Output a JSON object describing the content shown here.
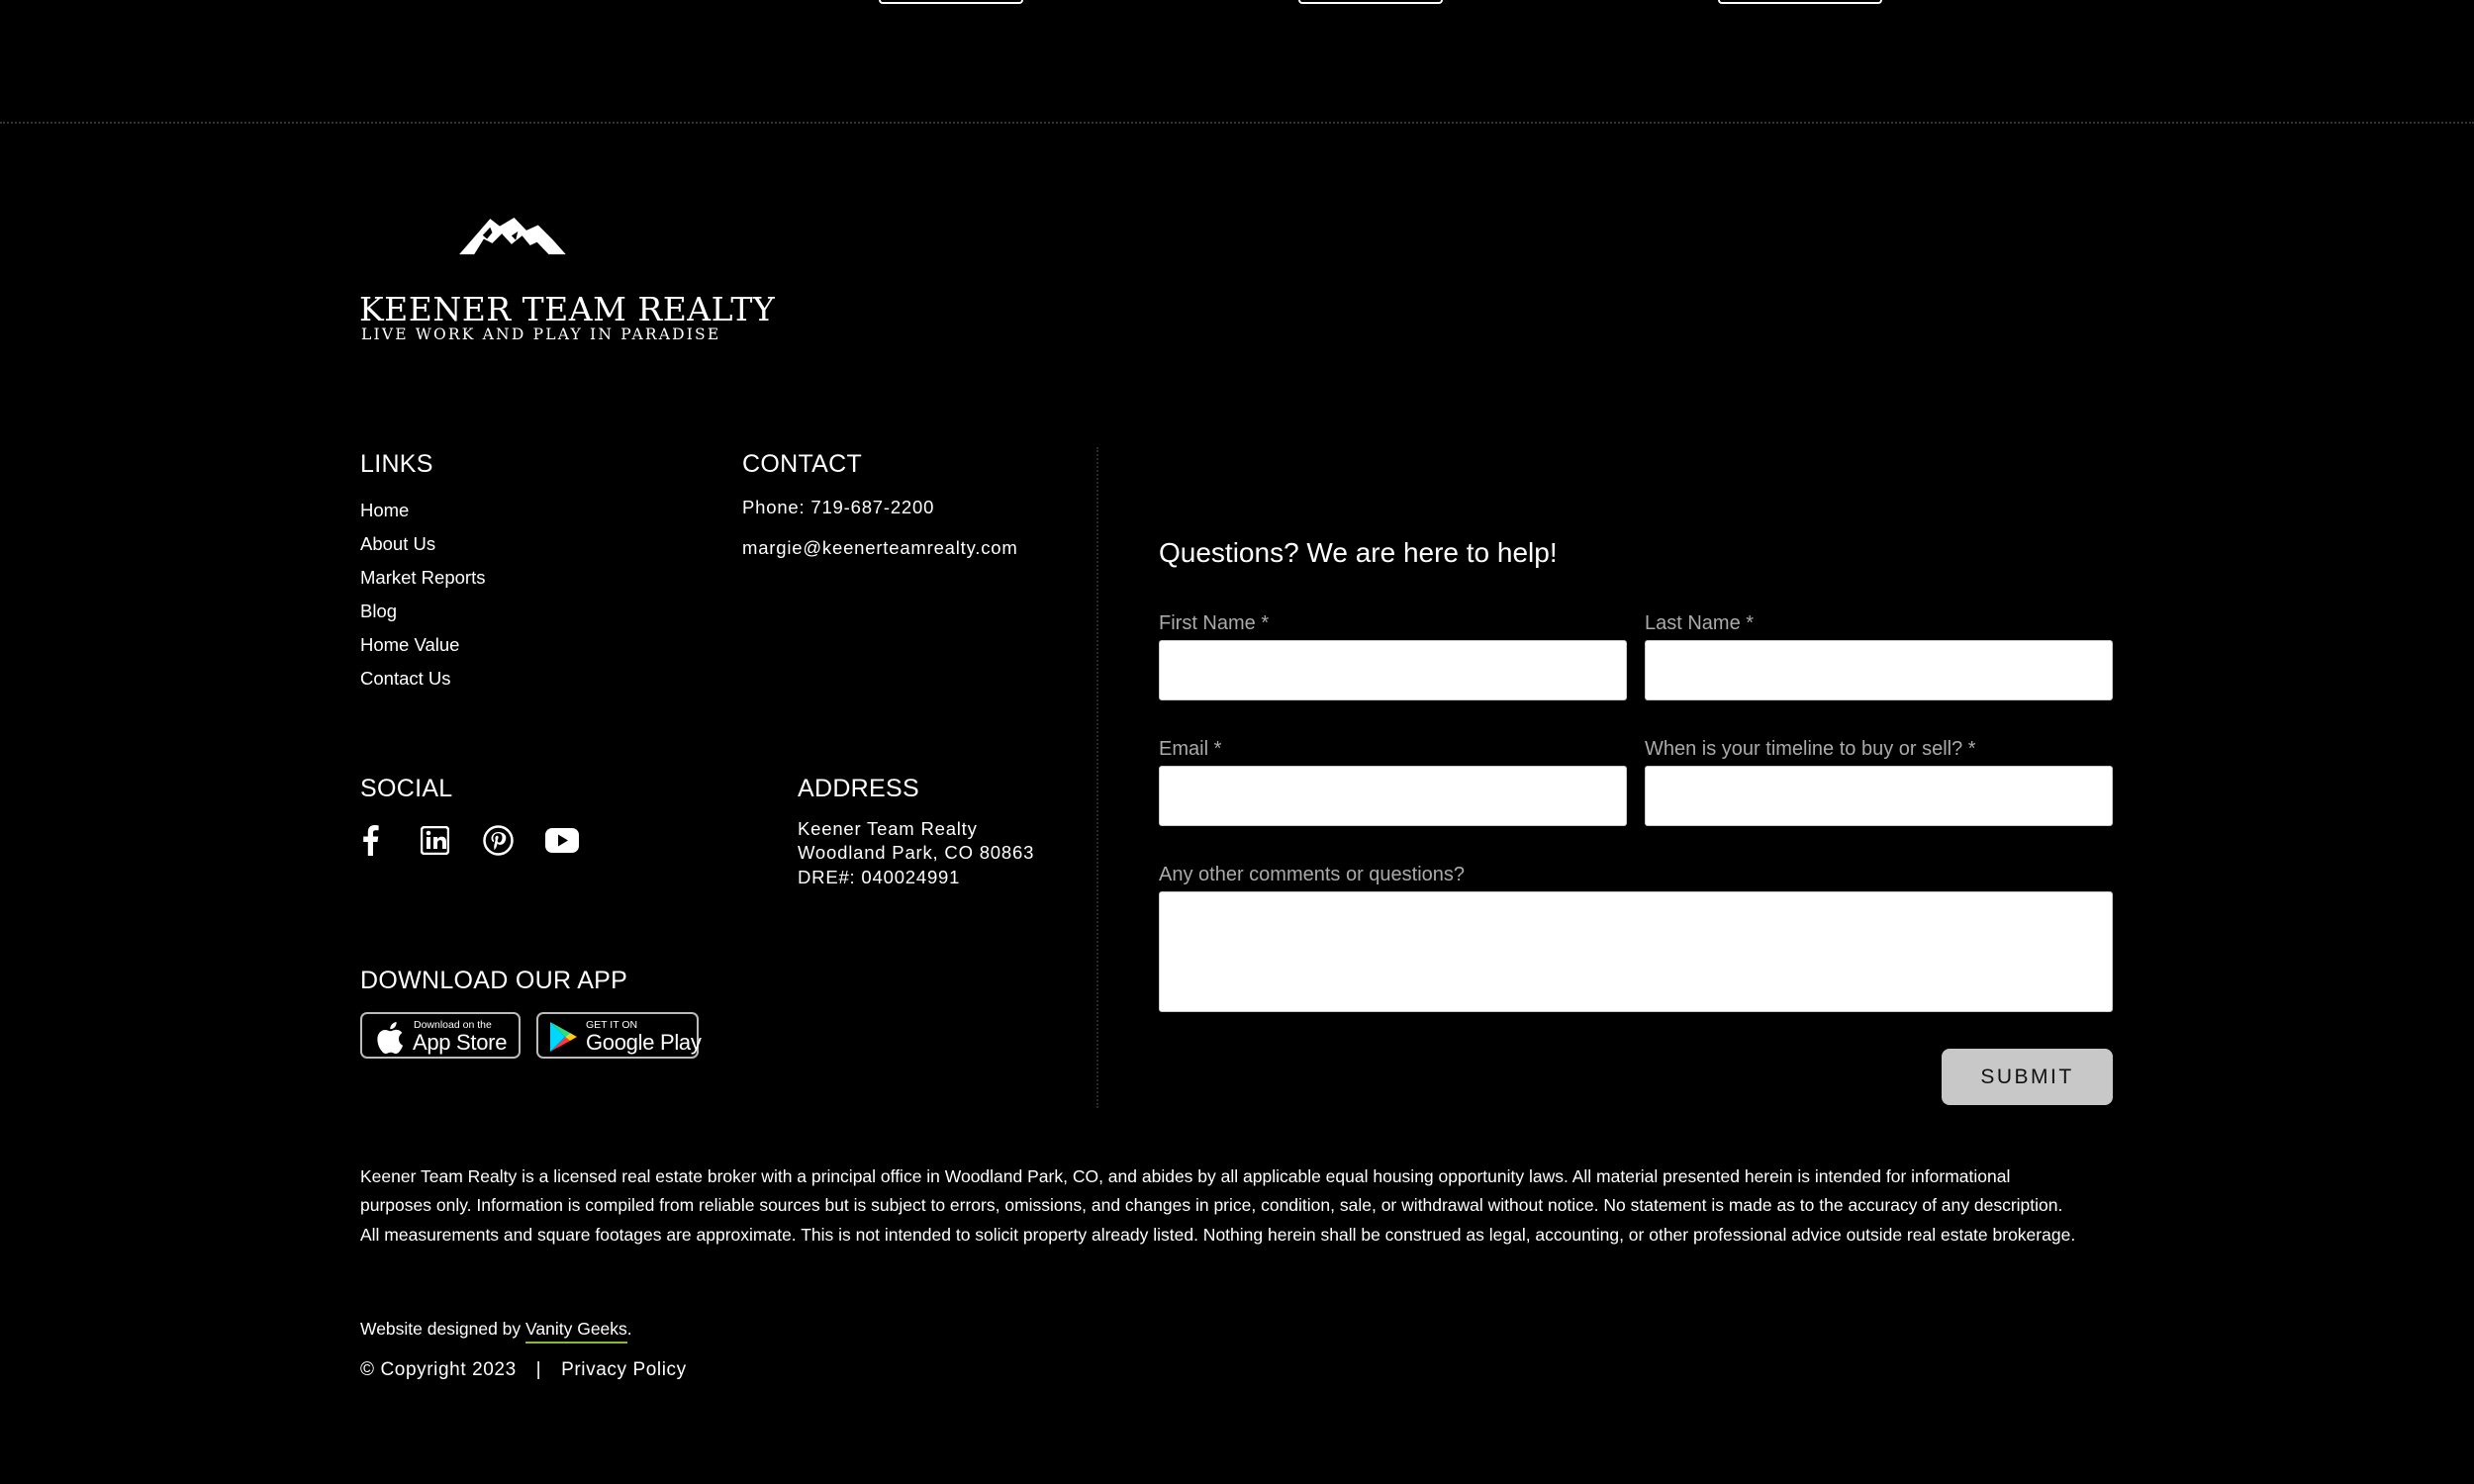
{
  "brand": {
    "name": "KEENER TEAM REALTY",
    "tagline": "LIVE WORK AND PLAY IN PARADISE"
  },
  "links": {
    "heading": "LINKS",
    "items": [
      "Home",
      "About Us",
      "Market Reports",
      "Blog",
      "Home Value",
      "Contact Us"
    ]
  },
  "contact": {
    "heading": "CONTACT",
    "phone": "Phone: 719-687-2200",
    "email": "margie@keenerteamrealty.com"
  },
  "social": {
    "heading": "SOCIAL",
    "icons": [
      "facebook-icon",
      "linkedin-icon",
      "pinterest-icon",
      "youtube-icon"
    ]
  },
  "address": {
    "heading": "ADDRESS",
    "line1": "Keener Team Realty",
    "line2": "Woodland Park, CO 80863",
    "line3": "DRE#: 040024991"
  },
  "app": {
    "heading": "DOWNLOAD OUR APP",
    "app_store_small": "Download on the",
    "app_store_large": "App Store",
    "google_play_small": "GET IT ON",
    "google_play_large": "Google Play"
  },
  "form": {
    "title": "Questions? We are here to help!",
    "first_name_label": "First Name *",
    "last_name_label": "Last Name *",
    "email_label": "Email *",
    "timeline_label": "When is your timeline to buy or sell? *",
    "comments_label": "Any other comments or questions?",
    "first_name_value": "",
    "last_name_value": "",
    "email_value": "",
    "timeline_value": "",
    "comments_value": "",
    "submit_label": "SUBMIT"
  },
  "footer": {
    "disclaimer": "Keener Team Realty is a licensed real estate broker with a principal office in Woodland Park, CO, and abides by all applicable equal housing opportunity laws. All material presented herein is intended for informational purposes only. Information is compiled from reliable sources but is subject to errors, omissions, and changes in price, condition, sale, or withdrawal without notice. No statement is made as to the accuracy of any description. All measurements and square footages are approximate. This is not intended to solicit property already listed. Nothing herein shall be construed as legal, accounting, or other professional advice outside real estate brokerage.",
    "credit_prefix": "Website designed by ",
    "credit_link": "Vanity Geeks",
    "credit_suffix": ".",
    "copyright": "© Copyright 2023",
    "separator": "|",
    "privacy": "Privacy Policy"
  },
  "colors": {
    "background": "#000000",
    "text": "#ffffff",
    "label": "#aaaaaa",
    "submit_bg": "#c8c8c8",
    "credit_underline": "#8ab933"
  }
}
